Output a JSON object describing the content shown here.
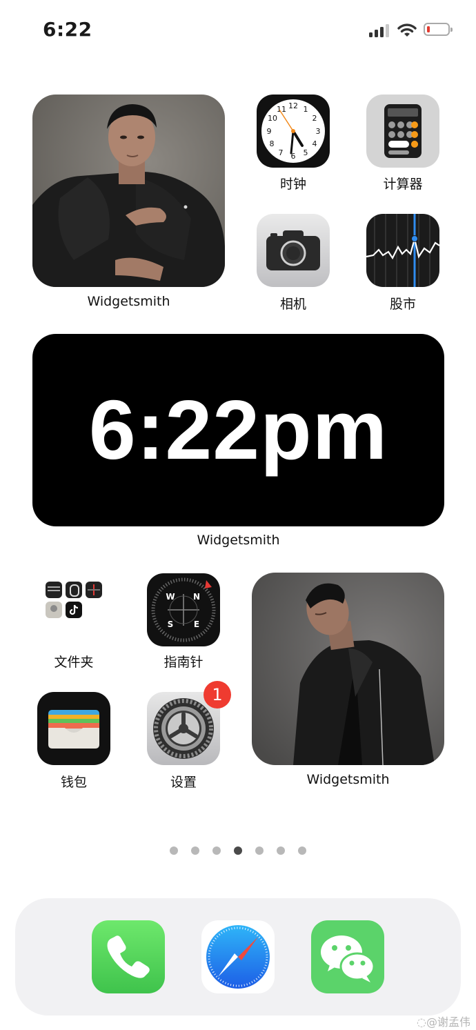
{
  "status_bar": {
    "time": "6:22"
  },
  "widgets": {
    "photo_top": {
      "label": "Widgetsmith"
    },
    "clock": {
      "time_text": "6:22pm",
      "label": "Widgetsmith"
    },
    "photo_bottom": {
      "label": "Widgetsmith"
    }
  },
  "apps": {
    "clock": {
      "label": "时钟",
      "numerals": [
        "12",
        "1",
        "2",
        "3",
        "4",
        "5",
        "6",
        "7",
        "8",
        "9",
        "10",
        "11"
      ]
    },
    "calculator": {
      "label": "计算器"
    },
    "camera": {
      "label": "相机"
    },
    "stocks": {
      "label": "股市"
    },
    "folder": {
      "label": "文件夹"
    },
    "compass": {
      "label": "指南针",
      "directions": {
        "n": "N",
        "s": "S",
        "e": "E",
        "w": "W"
      }
    },
    "wallet": {
      "label": "钱包"
    },
    "settings": {
      "label": "设置",
      "badge": "1"
    }
  },
  "page_dots": {
    "count": 7,
    "active_index": 3
  },
  "dock": {
    "apps": [
      "phone",
      "safari",
      "wechat"
    ]
  },
  "watermark": "@谢孟伟",
  "colors": {
    "badge_red": "#ef3b30",
    "phone_green": "#4cd964",
    "wechat_green": "#5bd36a",
    "safari_blue": "#2f8cf0"
  }
}
